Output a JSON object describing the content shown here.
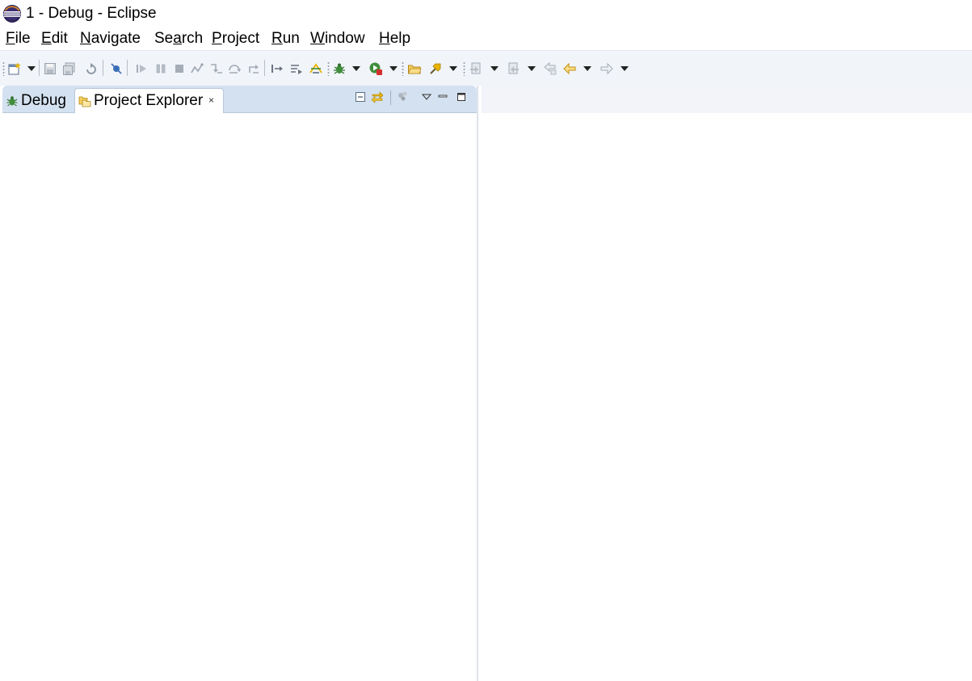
{
  "window": {
    "title": "1 - Debug - Eclipse",
    "logo_icon": "eclipse-logo-icon"
  },
  "menubar": {
    "items": [
      {
        "label": "File",
        "mnemonic": "F"
      },
      {
        "label": "Edit",
        "mnemonic": "E"
      },
      {
        "label": "Navigate",
        "mnemonic": "N"
      },
      {
        "label": "Search",
        "mnemonic": "a"
      },
      {
        "label": "Project",
        "mnemonic": "P"
      },
      {
        "label": "Run",
        "mnemonic": "R"
      },
      {
        "label": "Window",
        "mnemonic": "W"
      },
      {
        "label": "Help",
        "mnemonic": "H"
      }
    ]
  },
  "toolbar": {
    "icons": [
      "new-wizard-icon",
      "new-dropdown-icon",
      "save-icon",
      "save-all-icon",
      "refresh-icon",
      "skip-breakpoints-icon",
      "resume-icon",
      "suspend-icon",
      "terminate-icon",
      "disconnect-icon",
      "step-into-icon",
      "step-over-icon",
      "step-return-icon",
      "drop-to-frame-icon",
      "use-step-filters-icon",
      "debug-overlay-icon",
      "debug-icon",
      "debug-dropdown-icon",
      "run-icon",
      "run-dropdown-icon",
      "open-type-icon",
      "external-tools-icon",
      "external-tools-dropdown-icon",
      "next-annotation-icon",
      "next-annotation-dropdown-icon",
      "prev-annotation-icon",
      "prev-annotation-dropdown-icon",
      "last-edit-location-icon",
      "back-icon",
      "back-dropdown-icon",
      "forward-icon",
      "forward-dropdown-icon"
    ],
    "colors": {
      "background": "#f1f4f9",
      "accent_yellow": "#e8b400",
      "debug_green": "#3e8e3a",
      "run_red": "#d32f2f"
    }
  },
  "left_panel": {
    "tabs": [
      {
        "label": "Debug",
        "icon": "debug-bug-icon",
        "active": false
      },
      {
        "label": "Project Explorer",
        "icon": "project-explorer-folder-icon",
        "active": true,
        "close": "×"
      }
    ],
    "view_tools": [
      "collapse-all-icon",
      "link-with-editor-icon",
      "filter-icon",
      "view-menu-icon",
      "minimize-icon",
      "maximize-icon"
    ],
    "colors": {
      "tabbar": "#d4e1f0",
      "border": "#b9c8da"
    }
  },
  "editor_area": {
    "colors": {
      "header": "#f2f4f9"
    }
  }
}
